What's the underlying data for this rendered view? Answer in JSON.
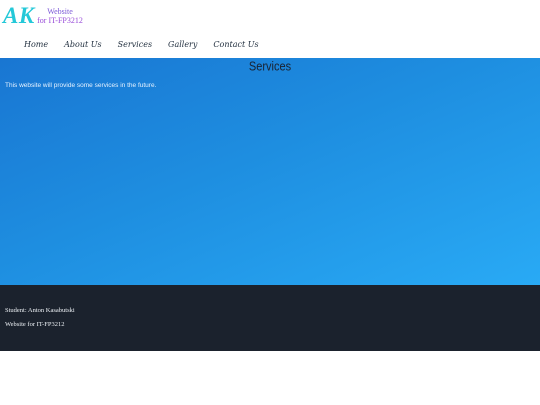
{
  "brand": {
    "logo": "AK",
    "subtitle_line1": "Website",
    "subtitle_line2": "for IT-FP3212",
    "colors": {
      "logo": "#24c8d8",
      "subtitle_line1": "#7a56d6",
      "subtitle_line2": "#9a4ed9"
    }
  },
  "nav": {
    "items": [
      {
        "label": "Home"
      },
      {
        "label": "About Us"
      },
      {
        "label": "Services"
      },
      {
        "label": "Gallery"
      },
      {
        "label": "Contact Us"
      }
    ]
  },
  "main": {
    "title": "Services",
    "text": "This website will provide some services in the future."
  },
  "footer": {
    "student": "Student: Anton Kasabutski",
    "course": "Website for IT-FP3212"
  }
}
